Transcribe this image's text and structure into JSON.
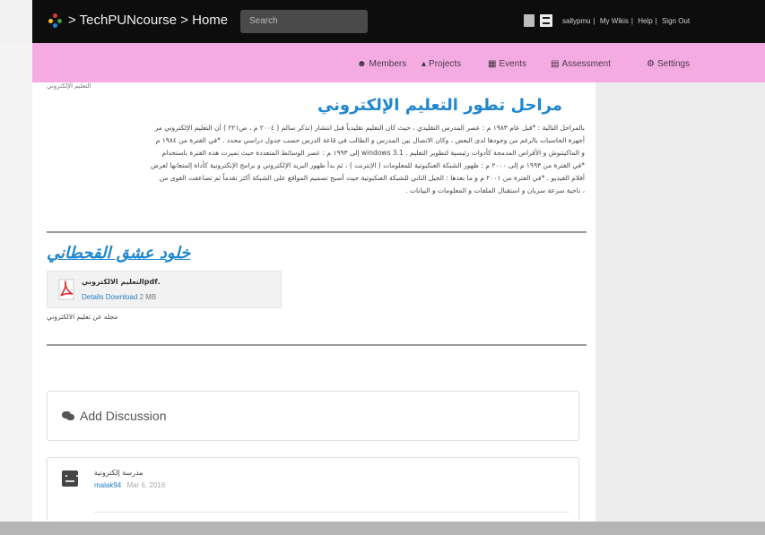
{
  "header": {
    "brand": "> TechPUNcourse > Home",
    "search_placeholder": "Search",
    "user_links": [
      "sallypmu",
      "My Wikis",
      "Help",
      "Sign Out"
    ]
  },
  "nav": {
    "items": [
      {
        "icon": "members-icon",
        "label": "Members"
      },
      {
        "icon": "projects-icon",
        "label": "Projects"
      },
      {
        "icon": "events-icon",
        "label": "Events"
      },
      {
        "icon": "assessment-icon",
        "label": "Assessment"
      },
      {
        "icon": "settings-icon",
        "label": "Settings"
      }
    ]
  },
  "page": {
    "crumb": "التعليم الإلكتروني",
    "heading1": "مراحل تطور التعليم الإلكتروني",
    "body_lines": [
      "بالمراحل التالية : *قبل عام ١٩٨٣ م : عصر المدرس التقليدي ، حيث كان التعليم تقليدياً قبل انتشار (تذكر سالم ( ٢٠٠٤ م ، ص٢٢١ ) أن التعليم الإلكتروني مر",
      "أجهزة الحاسبات بالرغم من وجودها لدى البعض ، وكان الاتصال بين المدرس و الطالب في قاعة الدرس حسب جدول دراسي محدد . *في الفترة من ١٩٨٤ م",
      "و الماكينتوش و الأقراص المدمجة كأدوات رئيسية لتطوير التعليم . 3.1 windows إلى ١٩٩٣ م : عصر الوسائط المتعددة حيث تميزت هذه الفترة باستخدام",
      "*في الفترة من ١٩٩٣ م إلى ٢٠٠٠ م : ظهور الشبكة العنكبوتية للمعلومات ( الإنترنت ) ، ثم بدأ ظهور البريد الإلكتروني و برامج الإنكترونية كأداة إلمتعانها لعرض",
      "أفلام الفيديو . *في الفترة من ٢٠٠١ م و ما بعدها : الجيل الثاني للشبكة العنكبوتية حيث أصبح تصميم المواقع على الشبكة أكثر تقدماً ثم تضاعفت القوى من",
      "، ناحية سرعة سريان و استقبال الملفات و المعلومات و البيانات ."
    ],
    "heading2": "خلود عشق القحطاني",
    "attachment": {
      "name": ".pdfالتعليم الالكتروني",
      "details": "Details",
      "download": "Download",
      "size": "2 MB"
    },
    "attachment_desc": "مجله عن تعليم الالكتروني"
  },
  "discussion": {
    "add_label": "Add Discussion",
    "post": {
      "title": "مدرسة إلكترونية",
      "author": "malak94",
      "date": "Mar 6, 2016"
    }
  },
  "colors": {
    "pink": "#f3abe1",
    "link_blue": "#1f86cf",
    "topbar": "#0d0d0d"
  }
}
